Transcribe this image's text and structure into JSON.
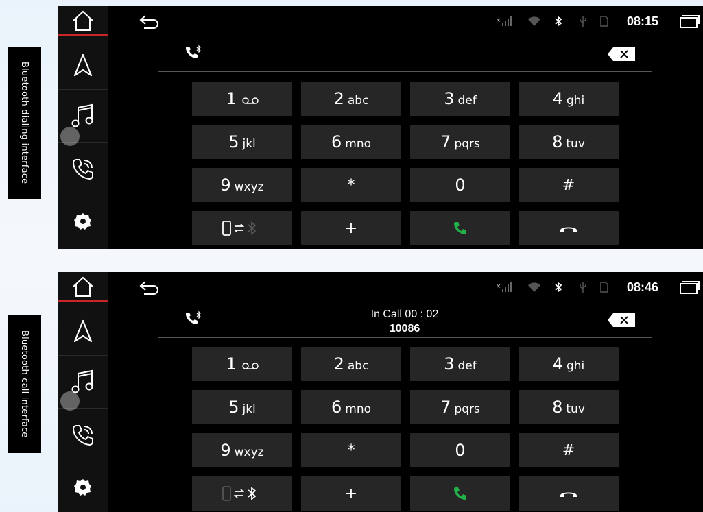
{
  "panels": [
    {
      "caption": "Bluetooth dialing interface",
      "status": {
        "time": "08:15"
      },
      "call": {
        "status": "",
        "number": ""
      },
      "keys": [
        {
          "digit": "1",
          "letters": "",
          "icon": "voicemail-icon"
        },
        {
          "digit": "2",
          "letters": "abc"
        },
        {
          "digit": "3",
          "letters": "def"
        },
        {
          "digit": "4",
          "letters": "ghi"
        },
        {
          "digit": "5",
          "letters": "jkl"
        },
        {
          "digit": "6",
          "letters": "mno"
        },
        {
          "digit": "7",
          "letters": "pqrs"
        },
        {
          "digit": "8",
          "letters": "tuv"
        },
        {
          "digit": "9",
          "letters": "wxyz"
        },
        {
          "digit": "*",
          "letters": ""
        },
        {
          "digit": "0",
          "letters": ""
        },
        {
          "digit": "#",
          "letters": ""
        },
        {
          "digit": "",
          "letters": "",
          "icon": "phone-bluetooth-switch-icon"
        },
        {
          "digit": "+",
          "letters": ""
        },
        {
          "digit": "",
          "letters": "",
          "icon": "call-icon"
        },
        {
          "digit": "",
          "letters": "",
          "icon": "hangup-icon"
        }
      ]
    },
    {
      "caption": "Bluetooth call interface",
      "status": {
        "time": "08:46"
      },
      "call": {
        "status": "In Call  00 : 02",
        "number": "10086"
      },
      "keys": [
        {
          "digit": "1",
          "letters": "",
          "icon": "voicemail-icon"
        },
        {
          "digit": "2",
          "letters": "abc"
        },
        {
          "digit": "3",
          "letters": "def"
        },
        {
          "digit": "4",
          "letters": "ghi"
        },
        {
          "digit": "5",
          "letters": "jkl"
        },
        {
          "digit": "6",
          "letters": "mno"
        },
        {
          "digit": "7",
          "letters": "pqrs"
        },
        {
          "digit": "8",
          "letters": "tuv"
        },
        {
          "digit": "9",
          "letters": "wxyz"
        },
        {
          "digit": "*",
          "letters": ""
        },
        {
          "digit": "0",
          "letters": ""
        },
        {
          "digit": "#",
          "letters": ""
        },
        {
          "digit": "",
          "letters": "",
          "icon": "phone-bluetooth-switch-icon"
        },
        {
          "digit": "+",
          "letters": ""
        },
        {
          "digit": "",
          "letters": "",
          "icon": "call-icon"
        },
        {
          "digit": "",
          "letters": "",
          "icon": "hangup-icon"
        }
      ]
    }
  ],
  "sidebar_icons": [
    "home-icon",
    "navigation-icon",
    "music-icon",
    "phone-icon",
    "settings-icon"
  ],
  "status_icons": [
    "back-icon",
    "no-signal-icon",
    "wifi-icon",
    "bluetooth-icon",
    "usb-icon",
    "sd-card-icon",
    "recent-apps-icon",
    "night-mode-icon"
  ],
  "colors": {
    "accent_red": "#c8252b",
    "call_green": "#21b24a",
    "key_bg": "#262626",
    "screen_bg": "#000000"
  }
}
